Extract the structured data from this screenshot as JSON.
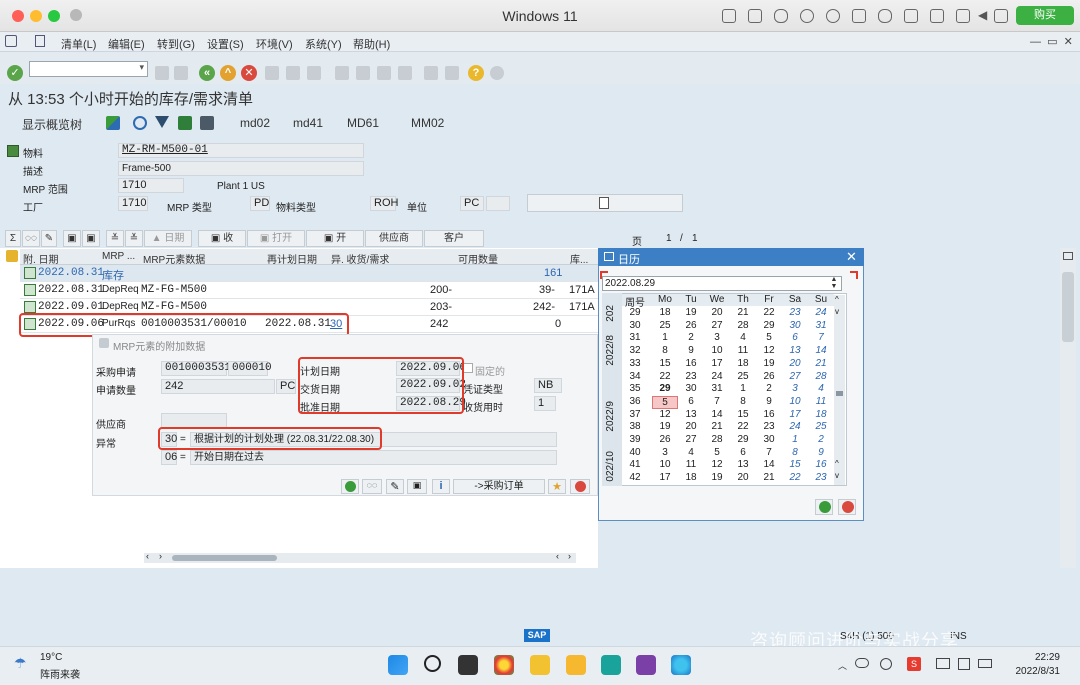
{
  "window": {
    "title": "Windows 11",
    "buy_label": "购买"
  },
  "menu": [
    "清单(L)",
    "编辑(E)",
    "转到(G)",
    "设置(S)",
    "环境(V)",
    "系统(Y)",
    "帮助(H)"
  ],
  "page_title": "从 13:53 个小时开始的库存/需求清单",
  "toolbar2": {
    "overview": "显示概览树",
    "b1": "md02",
    "b2": "md41",
    "b3": "MD61",
    "b4": "MM02"
  },
  "header": {
    "material_label": "物料",
    "material": "MZ-RM-M500-01",
    "desc_label": "描述",
    "desc": "Frame-500",
    "mrp_area_label": "MRP 范围",
    "mrp_area": "1710",
    "mrp_area_text": "Plant 1 US",
    "plant_label": "工厂",
    "plant": "1710",
    "mrp_type_label": "MRP 类型",
    "mrp_type": "PD",
    "mat_type_label": "物料类型",
    "mat_type": "ROH",
    "unit_label": "单位",
    "unit": "PC"
  },
  "grid_toolbar": {
    "date": "日期",
    "recv": "收",
    "open": "打开",
    "open2": "开",
    "vendor": "供应商",
    "customer": "客户",
    "page_label": "页",
    "page": "1",
    "page_sep": "/",
    "page_total": "1"
  },
  "grid": {
    "headers": [
      "附. 日期",
      "MRP ...",
      "MRP元素数据",
      "再计划日期",
      "异. 收货/需求",
      "可用数量",
      "库..."
    ],
    "rows": [
      {
        "date": "2022.08.31",
        "elem": "库存",
        "data": "",
        "resched": "",
        "exc": "",
        "qty": "",
        "avail": "161",
        "stor": ""
      },
      {
        "date": "2022.08.31",
        "elem": "DepReq",
        "data": "MZ-FG-M500",
        "resched": "",
        "exc": "",
        "qty": "200-",
        "avail": "39-",
        "stor": "171A"
      },
      {
        "date": "2022.09.01",
        "elem": "DepReq",
        "data": "MZ-FG-M500",
        "resched": "",
        "exc": "",
        "qty": "203-",
        "avail": "242-",
        "stor": "171A"
      },
      {
        "date": "2022.09.06",
        "elem": "PurRqs",
        "data": "0010003531/00010",
        "resched": "2022.08.31",
        "exc": "30",
        "qty": "242",
        "avail": "0",
        "stor": ""
      }
    ]
  },
  "detail": {
    "title": "MRP元素的附加数据",
    "pr_label": "采购申请",
    "pr": "0010003531",
    "pr_item": "000010",
    "qty_label": "申请数量",
    "qty": "242",
    "qty_unit": "PC",
    "plan_label": "计划日期",
    "plan": "2022.09.06",
    "fixed_label": "固定的",
    "deliv_label": "交货日期",
    "deliv": "2022.09.02",
    "doctype_label": "凭证类型",
    "doctype": "NB",
    "release_label": "批准日期",
    "release": "2022.08.29",
    "gr_label": "收货用时",
    "gr": "1",
    "vendor_label": "供应商",
    "exc_label": "异常",
    "exc1_code": "30",
    "exc1_eq": "=",
    "exc1_text": "根据计划的计划处理 (22.08.31/22.08.30)",
    "exc2_code": "06",
    "exc2_eq": "=",
    "exc2_text": "开始日期在过去",
    "po_button": "->采购订单"
  },
  "calendar": {
    "title": "日历",
    "input": "2022.08.29",
    "week_label": "周号",
    "days": [
      "Mo",
      "Tu",
      "We",
      "Th",
      "Fr",
      "Sa",
      "Su"
    ],
    "month_labels": [
      "202",
      "2022/8",
      "2022/9",
      "022/10"
    ],
    "weeks": [
      {
        "w": "29",
        "d": [
          "18",
          "19",
          "20",
          "21",
          "22",
          "23",
          "24"
        ]
      },
      {
        "w": "30",
        "d": [
          "25",
          "26",
          "27",
          "28",
          "29",
          "30",
          "31"
        ]
      },
      {
        "w": "31",
        "d": [
          "1",
          "2",
          "3",
          "4",
          "5",
          "6",
          "7"
        ]
      },
      {
        "w": "32",
        "d": [
          "8",
          "9",
          "10",
          "11",
          "12",
          "13",
          "14"
        ]
      },
      {
        "w": "33",
        "d": [
          "15",
          "16",
          "17",
          "18",
          "19",
          "20",
          "21"
        ]
      },
      {
        "w": "34",
        "d": [
          "22",
          "23",
          "24",
          "25",
          "26",
          "27",
          "28"
        ]
      },
      {
        "w": "35",
        "d": [
          "29",
          "30",
          "31",
          "1",
          "2",
          "3",
          "4"
        ]
      },
      {
        "w": "36",
        "d": [
          "5",
          "6",
          "7",
          "8",
          "9",
          "10",
          "11"
        ]
      },
      {
        "w": "37",
        "d": [
          "12",
          "13",
          "14",
          "15",
          "16",
          "17",
          "18"
        ]
      },
      {
        "w": "38",
        "d": [
          "19",
          "20",
          "21",
          "22",
          "23",
          "24",
          "25"
        ]
      },
      {
        "w": "39",
        "d": [
          "26",
          "27",
          "28",
          "29",
          "30",
          "1",
          "2"
        ]
      },
      {
        "w": "40",
        "d": [
          "3",
          "4",
          "5",
          "6",
          "7",
          "8",
          "9"
        ]
      },
      {
        "w": "41",
        "d": [
          "10",
          "11",
          "12",
          "13",
          "14",
          "15",
          "16"
        ]
      },
      {
        "w": "42",
        "d": [
          "17",
          "18",
          "19",
          "20",
          "21",
          "22",
          "23"
        ]
      }
    ]
  },
  "status": {
    "sap": "SAP",
    "sid": "S4H (1) 500",
    "mode": "INS",
    "watermark": "咨询顾问进阶与实战分享"
  },
  "taskbar": {
    "temp": "19°C",
    "weather": "阵雨来袭",
    "time": "22:29",
    "date": "2022/8/31"
  }
}
